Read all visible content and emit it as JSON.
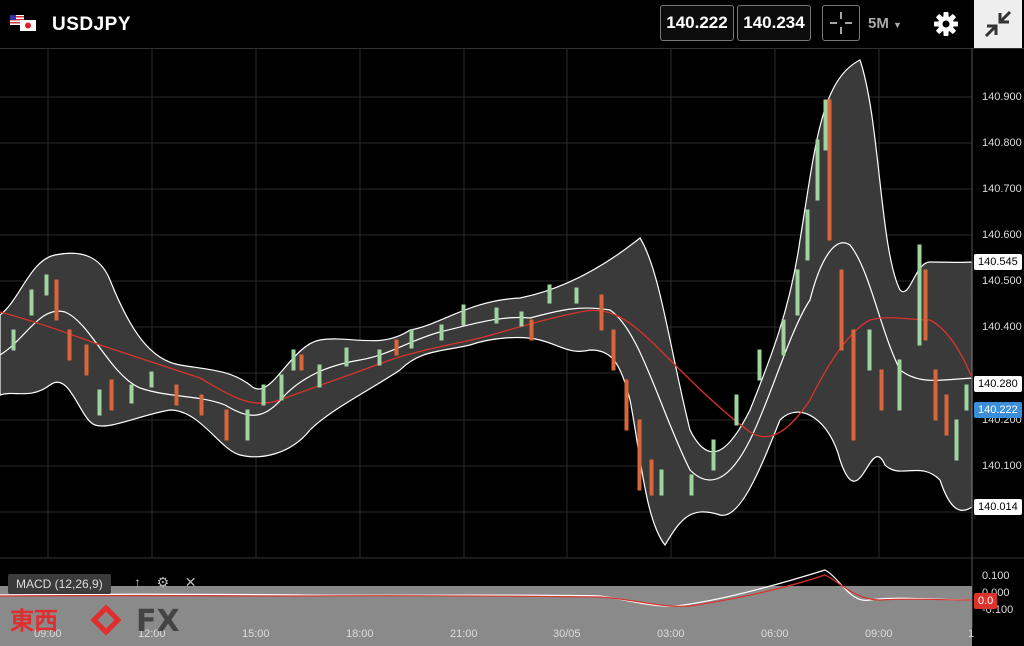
{
  "header": {
    "symbol": "USDJPY",
    "bid": "140.222",
    "ask": "140.234",
    "timeframe": "5M",
    "icons": [
      "us-jp-flag-icon",
      "crosshair-icon",
      "gear-icon",
      "collapse-icon"
    ]
  },
  "y_axis": {
    "ticks": [
      "140.900",
      "140.800",
      "140.700",
      "140.600",
      "140.500",
      "140.400",
      "140.200",
      "140.100"
    ],
    "tags": {
      "upper_band": "140.545",
      "ma": "140.280",
      "last_price": "140.222",
      "lower_band": "140.014"
    }
  },
  "x_axis": {
    "ticks": [
      "09:00",
      "12:00",
      "15:00",
      "18:00",
      "21:00",
      "30/05",
      "03:00",
      "06:00",
      "09:00",
      "1"
    ]
  },
  "macd": {
    "label": "MACD (12,26,9)",
    "ticks": [
      "0.100",
      "0.000",
      "-0.100"
    ],
    "value_tag": "0.0"
  },
  "brand": {
    "kanji": "東西",
    "fx": "FX"
  },
  "colors": {
    "background": "#000000",
    "band_fill": "#3a3a3a",
    "band_line": "#ffffff",
    "ma_line": "#d9332b",
    "bull": "#9fd3a0",
    "bear": "#d9663a",
    "last_price_tag": "#3b8fd8"
  }
}
